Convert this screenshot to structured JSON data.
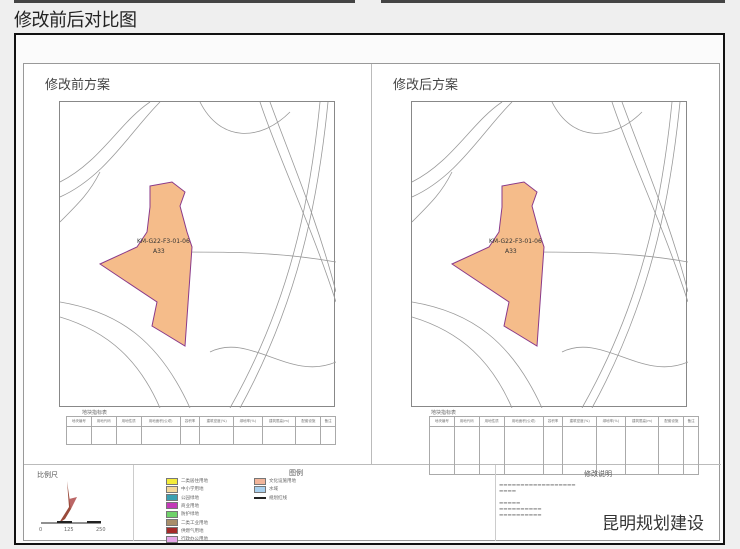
{
  "page_title": "修改前后对比图",
  "panels": [
    {
      "title": "修改前方案",
      "parcel_code": "KM-G22-F3-01-06",
      "land_use": "A33",
      "table_title": "地块指标表"
    },
    {
      "title": "修改后方案",
      "parcel_code": "KM-G22-F3-01-06",
      "land_use": "A33",
      "table_title": "地块指标表"
    }
  ],
  "table_headers": [
    "地块编号",
    "用地代码",
    "用地性质",
    "用地面积(公顷)",
    "容积率",
    "建筑密度(%)",
    "绿地率(%)",
    "建筑限高(m)",
    "配套设施",
    "备注"
  ],
  "scale": {
    "label": "比例尺",
    "ticks": [
      "0",
      "125",
      "250"
    ]
  },
  "legend": {
    "title": "图例",
    "items": [
      {
        "label": "二类居住用地",
        "color": "#f4ec3a"
      },
      {
        "label": "中小学用地",
        "color": "#f3d79a"
      },
      {
        "label": "公园绿地",
        "color": "#3a9fb0"
      },
      {
        "label": "商业用地",
        "color": "#c43ab8"
      },
      {
        "label": "防护绿地",
        "color": "#6fd26a"
      },
      {
        "label": "二类工业用地",
        "color": "#a88e6a"
      },
      {
        "label": "供燃气用地",
        "color": "#a52a2a"
      },
      {
        "label": "行政办公用地",
        "color": "#e4a6e8"
      },
      {
        "label": "文化设施用地",
        "color": "#f2b59a"
      },
      {
        "label": "水域",
        "color": "#a8d0ee"
      },
      {
        "label": "规划红线",
        "color": "#222222"
      }
    ]
  },
  "notes": {
    "title": "修改说明"
  },
  "watermark": "昆明规划建设",
  "parcel_color": "#f5bc8a"
}
